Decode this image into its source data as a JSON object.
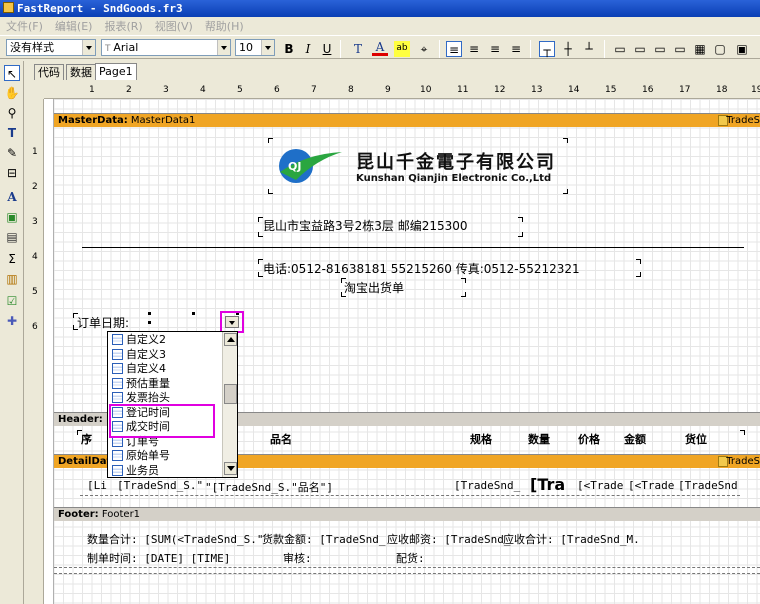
{
  "window": {
    "title": "FastReport - SndGoods.fr3"
  },
  "menu": [
    "文件(F)",
    "编辑(E)",
    "报表(R)",
    "视图(V)",
    "帮助(H)"
  ],
  "toolbar": {
    "style_value": "没有样式",
    "font_value": "Arial",
    "size_value": "10",
    "bold": "B",
    "italic": "I",
    "underline": "U"
  },
  "tabs": [
    "代码",
    "数据",
    "Page1"
  ],
  "rulers": {
    "h": [
      "1",
      "2",
      "3",
      "4",
      "5",
      "6",
      "7",
      "8",
      "9",
      "10",
      "11",
      "12",
      "13",
      "14",
      "15",
      "16",
      "17",
      "18",
      "19"
    ],
    "v": [
      "1",
      "2",
      "3",
      "4",
      "5",
      "6"
    ]
  },
  "bands": {
    "master": {
      "label": "MasterData:",
      "name": "MasterData1",
      "datasource": "TradeS"
    },
    "header": {
      "label": "Header:",
      "name": "H"
    },
    "detail": {
      "label": "DetailDat",
      "datasource": "TradeS"
    },
    "footer": {
      "label": "Footer:",
      "name": "Footer1"
    }
  },
  "logo": {
    "cn": "昆山千金電子有限公司",
    "en": "Kunshan Qianjin Electronic Co.,Ltd",
    "mark": "QJ"
  },
  "report": {
    "address": "昆山市宝益路3号2栋3层    邮编215300",
    "phone": "电话:0512-81638181 55215260  传真:0512-55212321",
    "title": "淘宝出货单",
    "order_date": "订单日期:"
  },
  "dropdown": {
    "items": [
      "自定义2",
      "自定义3",
      "自定义4",
      "预估重量",
      "发票抬头",
      "登记时间",
      "成交时间",
      "订单号",
      "原始单号",
      "业务员"
    ]
  },
  "header_cols": [
    "序",
    "品名",
    "规格",
    "数量",
    "价格",
    "金额",
    "货位"
  ],
  "detail_cells": [
    "[Li",
    "[TradeSnd_S.\"",
    "\"[TradeSnd_S.\"品名\"]",
    "[TradeSnd_",
    "[Tra",
    "[<Trade",
    "[<Trade",
    "[TradeSnd"
  ],
  "footer_row1": [
    "数量合计: [SUM(<TradeSnd_S.\"",
    "货款金额: [TradeSnd_",
    "应收邮资: [TradeSnd_",
    "应收合计: [TradeSnd_M."
  ],
  "footer_row2": [
    "制单时间: [DATE] [TIME]",
    "审核:",
    "配货:"
  ]
}
